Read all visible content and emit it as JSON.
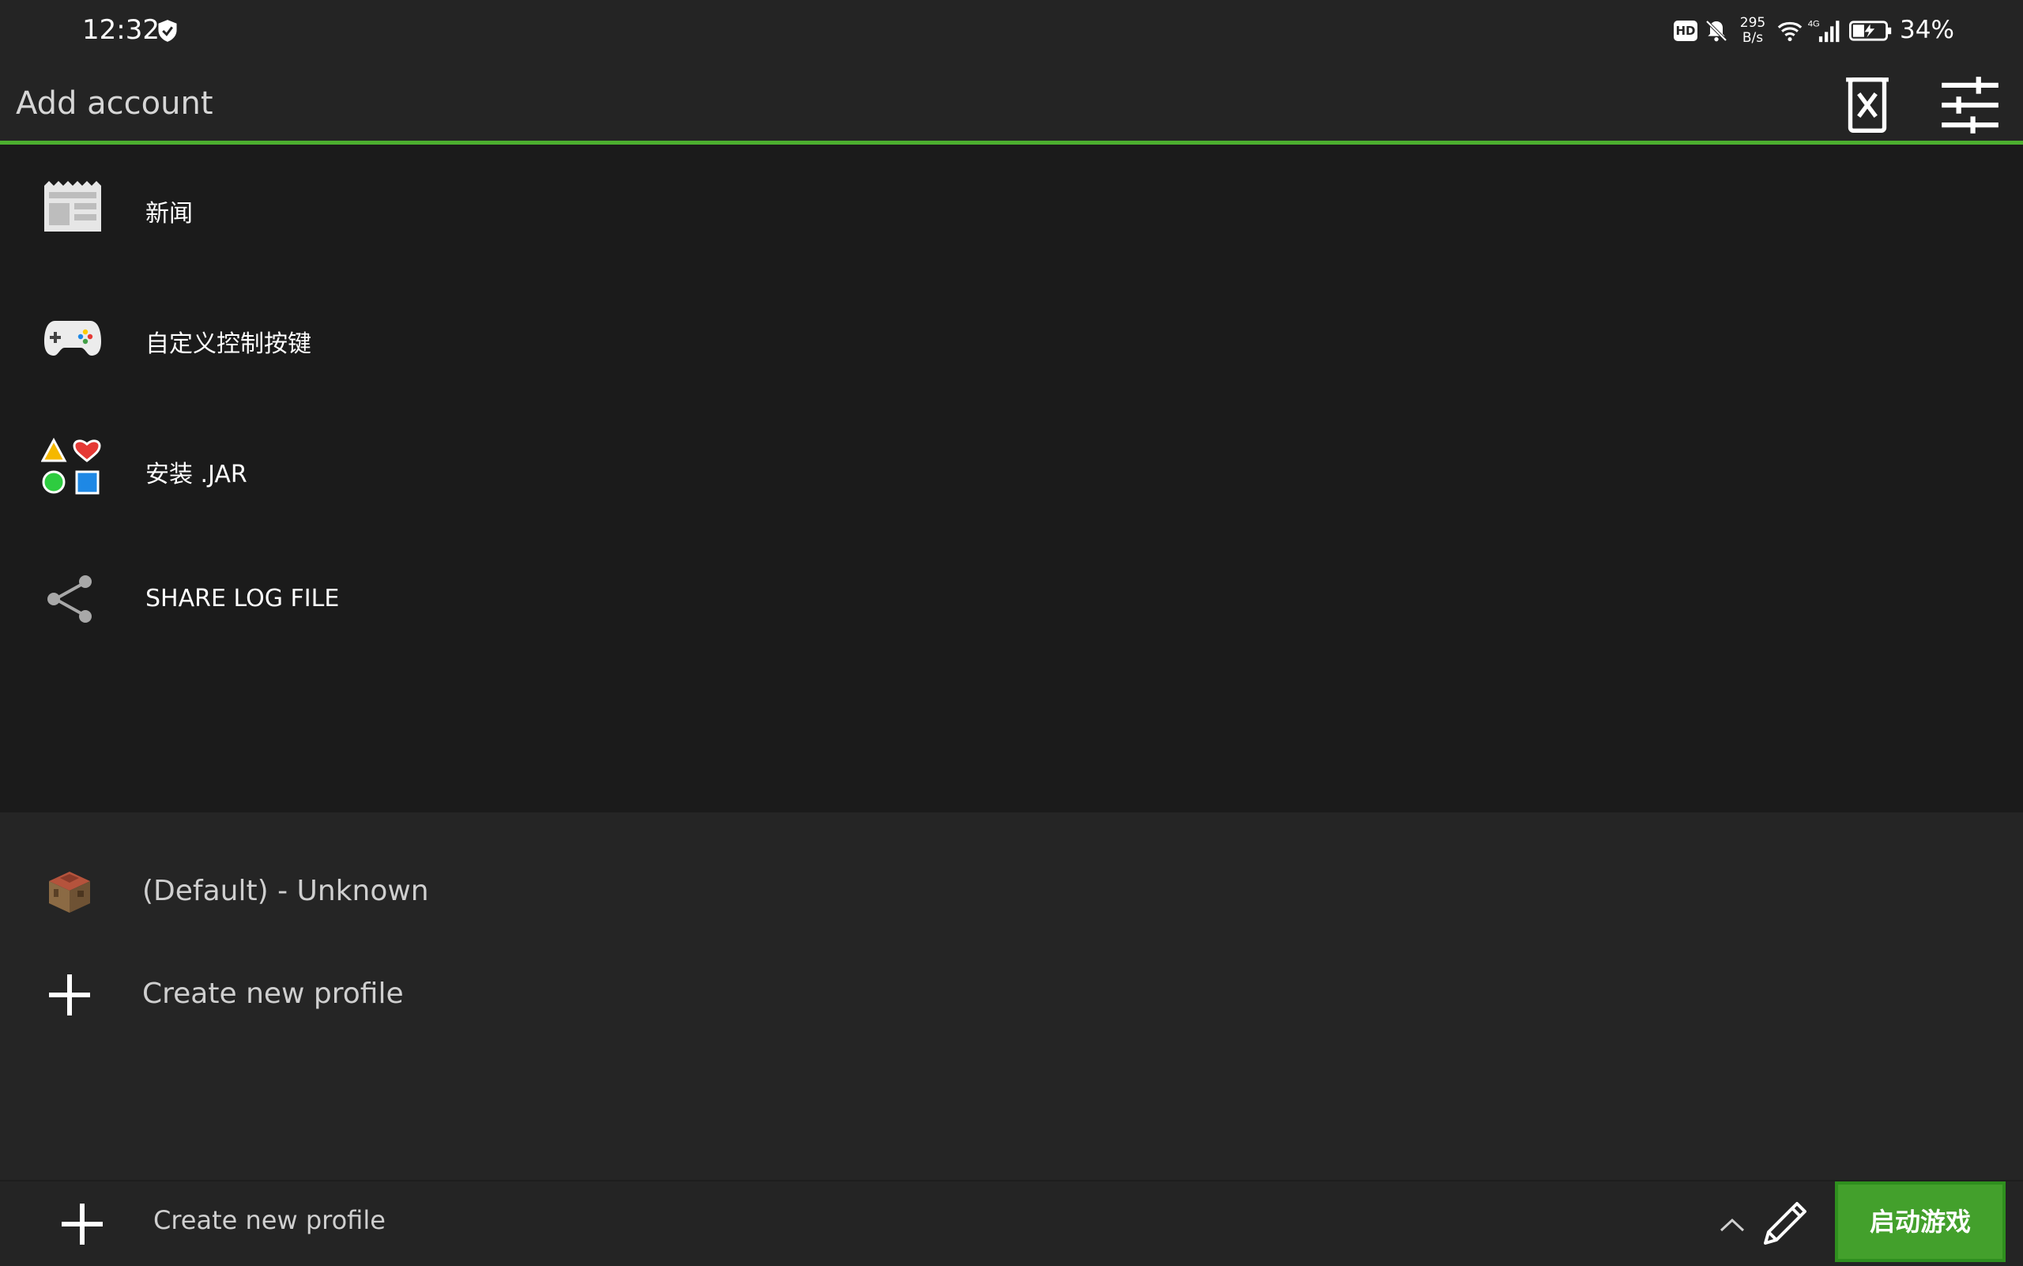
{
  "status_bar": {
    "time": "12:32",
    "hd_badge": "HD",
    "net_speed_value": "295",
    "net_speed_unit": "B/s",
    "signal_type": "4G",
    "battery_percent": "34%"
  },
  "top_bar": {
    "title": "Add account",
    "delete_icon": "delete-account-icon",
    "settings_icon": "sliders-settings-icon",
    "accent_color": "#4caf2f"
  },
  "menu": {
    "items": [
      {
        "label": "新闻",
        "icon": "news-icon"
      },
      {
        "label": "自定义控制按键",
        "icon": "gamepad-icon"
      },
      {
        "label": "安装 .JAR",
        "icon": "shapes-icon"
      },
      {
        "label": "SHARE LOG FILE",
        "icon": "share-icon"
      }
    ]
  },
  "profiles": {
    "items": [
      {
        "label": "(Default) - Unknown",
        "icon": "crafting-table-icon"
      },
      {
        "label": "Create new profile",
        "icon": "plus-icon"
      }
    ]
  },
  "bottom_bar": {
    "selected_profile": "Create new profile",
    "launch_label": "启动游戏",
    "launch_color": "#43a02c"
  }
}
